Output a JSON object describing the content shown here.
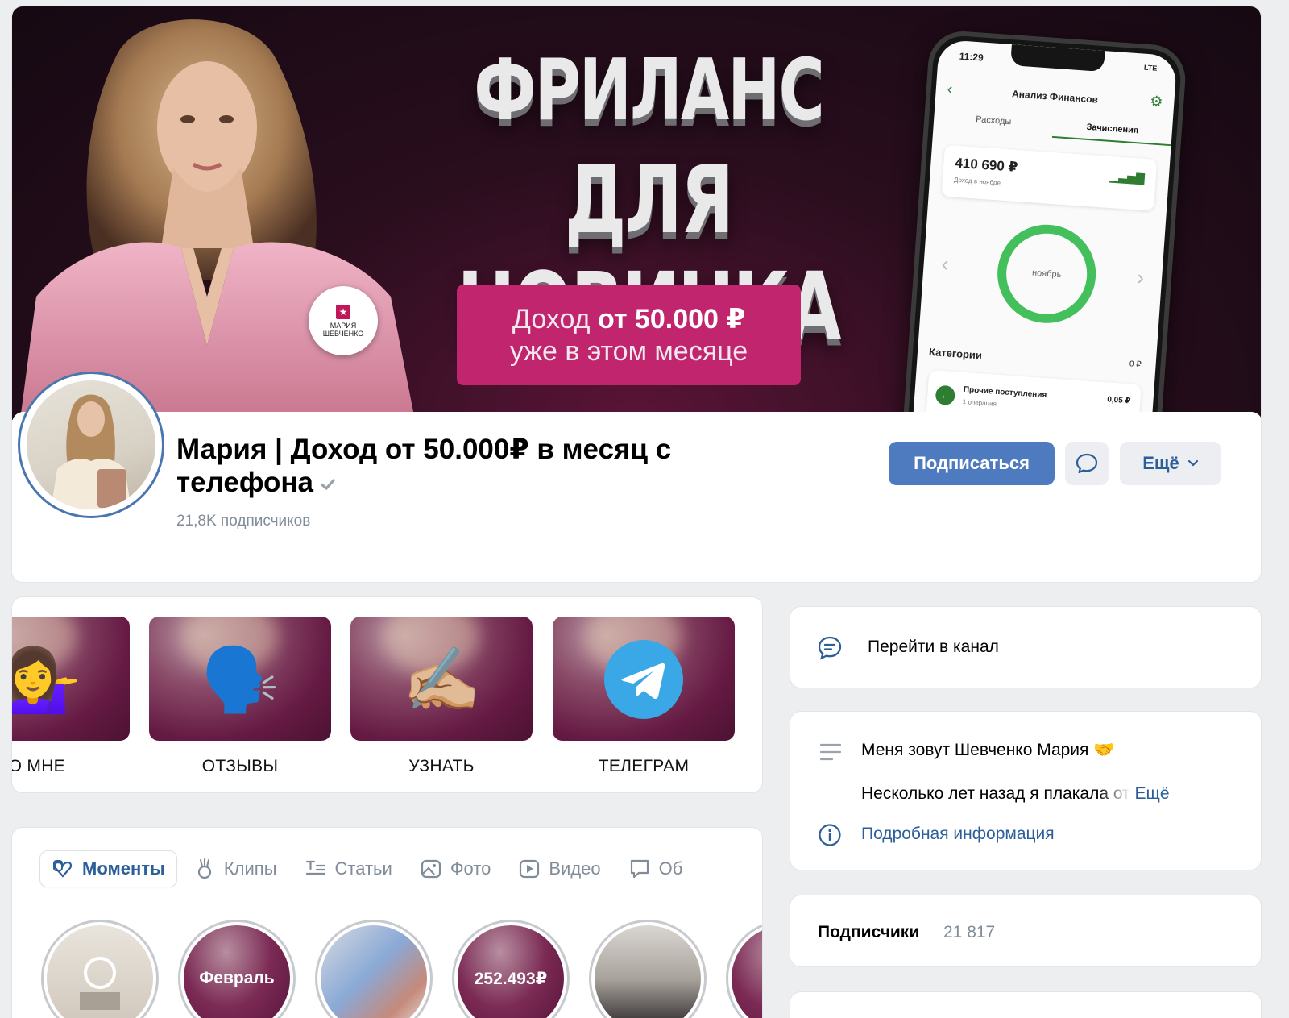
{
  "cover": {
    "title_line1": "ФРИЛАНС",
    "title_line2": "ДЛЯ НОВИЧКА",
    "pill_prefix": "Доход ",
    "pill_bold": "от 50.000 ₽",
    "pill_line2": "уже в этом месяце",
    "logo_text": "МАРИЯ ШЕВЧЕНКО",
    "phone": {
      "time": "11:29",
      "network": "LTE",
      "title": "Анализ Финансов",
      "tab_expenses": "Расходы",
      "tab_income": "Зачисления",
      "amount": "410 690 ₽",
      "amount_sub": "Доход в ноябре",
      "ring_label": "ноябрь",
      "categories_label": "Категории",
      "categories_value": "0 ₽",
      "row_title": "Прочие поступления",
      "row_sub": "1 операция",
      "row_value": "0,05 ₽"
    }
  },
  "profile": {
    "name": "Мария | Доход от 50.000₽ в месяц с телефона",
    "subscribers": "21,8K подписчиков",
    "subscribe_label": "Подписаться",
    "more_label": "Ещё"
  },
  "links": [
    {
      "label": "ОБО МНЕ",
      "emoji": "💁‍♀️"
    },
    {
      "label": "ОТЗЫВЫ",
      "emoji": "🗣️"
    },
    {
      "label": "УЗНАТЬ",
      "emoji": "✍🏼"
    },
    {
      "label": "ТЕЛЕГРАМ",
      "emoji": "telegram"
    }
  ],
  "tabs": [
    {
      "label": "Моменты",
      "icon": "moments-icon",
      "active": true
    },
    {
      "label": "Клипы",
      "icon": "clips-icon"
    },
    {
      "label": "Статьи",
      "icon": "articles-icon"
    },
    {
      "label": "Фото",
      "icon": "photo-icon"
    },
    {
      "label": "Видео",
      "icon": "video-icon"
    },
    {
      "label": "Об",
      "icon": "discussion-icon"
    }
  ],
  "moments": [
    {
      "label": ""
    },
    {
      "label": "Февраль"
    },
    {
      "label": ""
    },
    {
      "label": "252.493₽"
    },
    {
      "label": ""
    },
    {
      "label": ""
    }
  ],
  "channel": {
    "label": "Перейти в канал"
  },
  "about": {
    "line1": "Меня зовут Шевченко Мария 🤝",
    "line2": "Несколько лет назад я плакала от",
    "more": "Ещё",
    "details": "Подробная информация"
  },
  "followers": {
    "label": "Подписчики",
    "count": "21 817"
  },
  "colors": {
    "accent": "#4e7bc0",
    "link": "#2c5f99",
    "muted": "#818c99",
    "cover_pill": "#c0256e",
    "ring": "#43c05b"
  }
}
